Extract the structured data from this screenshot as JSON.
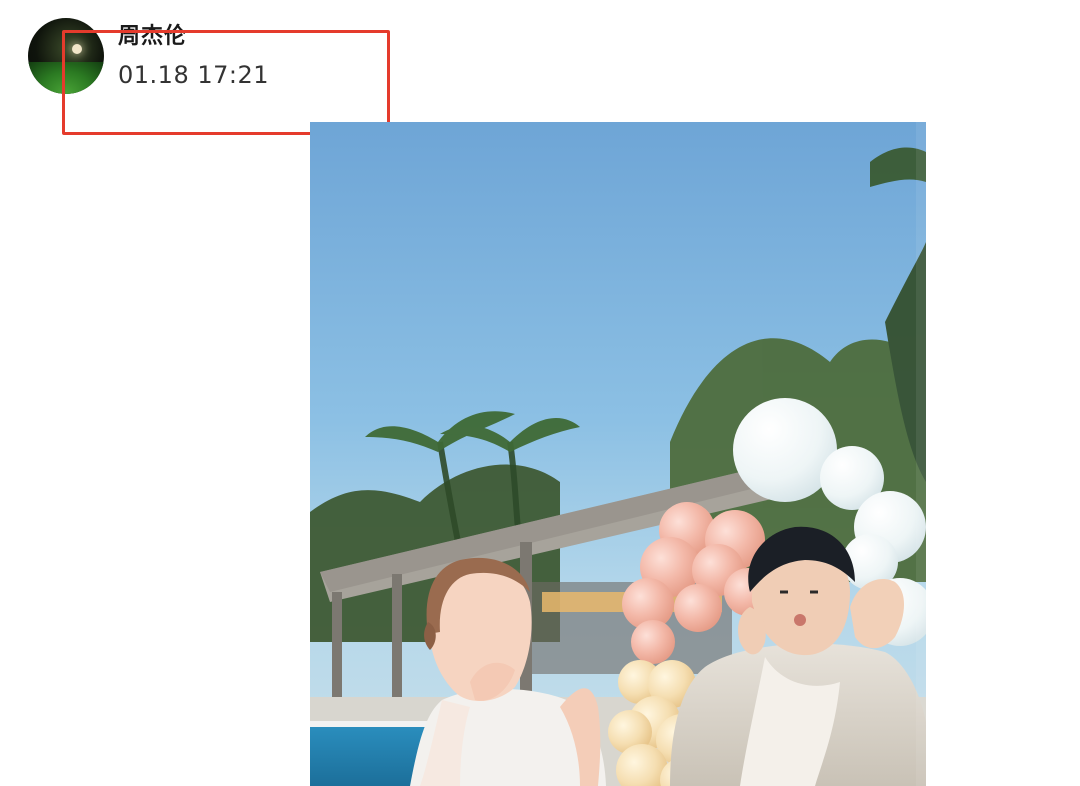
{
  "post": {
    "author": {
      "name": "周杰伦",
      "avatar_icon": "avatar-photo"
    },
    "timestamp": "01.18 17:21",
    "highlight_color": "#e53b2c",
    "image": {
      "kind": "photo",
      "description_icon": "photo-icon"
    }
  }
}
